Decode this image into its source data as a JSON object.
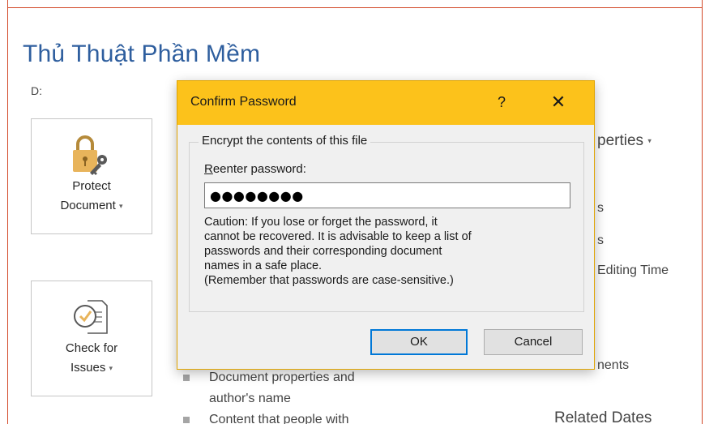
{
  "backstage": {
    "title": "Thủ Thuật Phần Mềm",
    "path": "D:",
    "tiles": {
      "protect": {
        "line1": "Protect",
        "line2": "Document",
        "caret": "▾"
      },
      "check": {
        "line1": "Check for",
        "line2": "Issues",
        "caret": "▾"
      }
    },
    "right_column": {
      "properties": "perties",
      "properties_caret": "▾",
      "s1": "s",
      "s2": "s",
      "editing_time": "Editing Time",
      "ments": "nents",
      "related_dates": "Related Dates"
    },
    "bullets": {
      "line1": "Document properties and",
      "line2": "author's name",
      "line3": "Content that people with"
    }
  },
  "dialog": {
    "title": "Confirm Password",
    "help": "?",
    "close": "✕",
    "group_legend": "Encrypt the contents of this file",
    "field_label_accel": "R",
    "field_label_rest": "eenter password:",
    "password_value": "●●●●●●●●",
    "caution_line1": "Caution: If you lose or forget the password, it",
    "caution_line2": "cannot be recovered. It is advisable to keep a list of",
    "caution_line3": "passwords and their corresponding document",
    "caution_line4": "names in a safe place.",
    "caution_line5": "(Remember that passwords are case-sensitive.)",
    "ok_label": "OK",
    "cancel_label": "Cancel"
  },
  "colors": {
    "accent_red": "#d24726",
    "title_blue": "#2e5e9e",
    "dialog_titlebar": "#fcc21b",
    "ok_focus": "#0078d7"
  },
  "icons": {
    "protect": "lock-key-icon",
    "check": "check-document-icon",
    "close": "close-icon",
    "help": "help-icon"
  }
}
